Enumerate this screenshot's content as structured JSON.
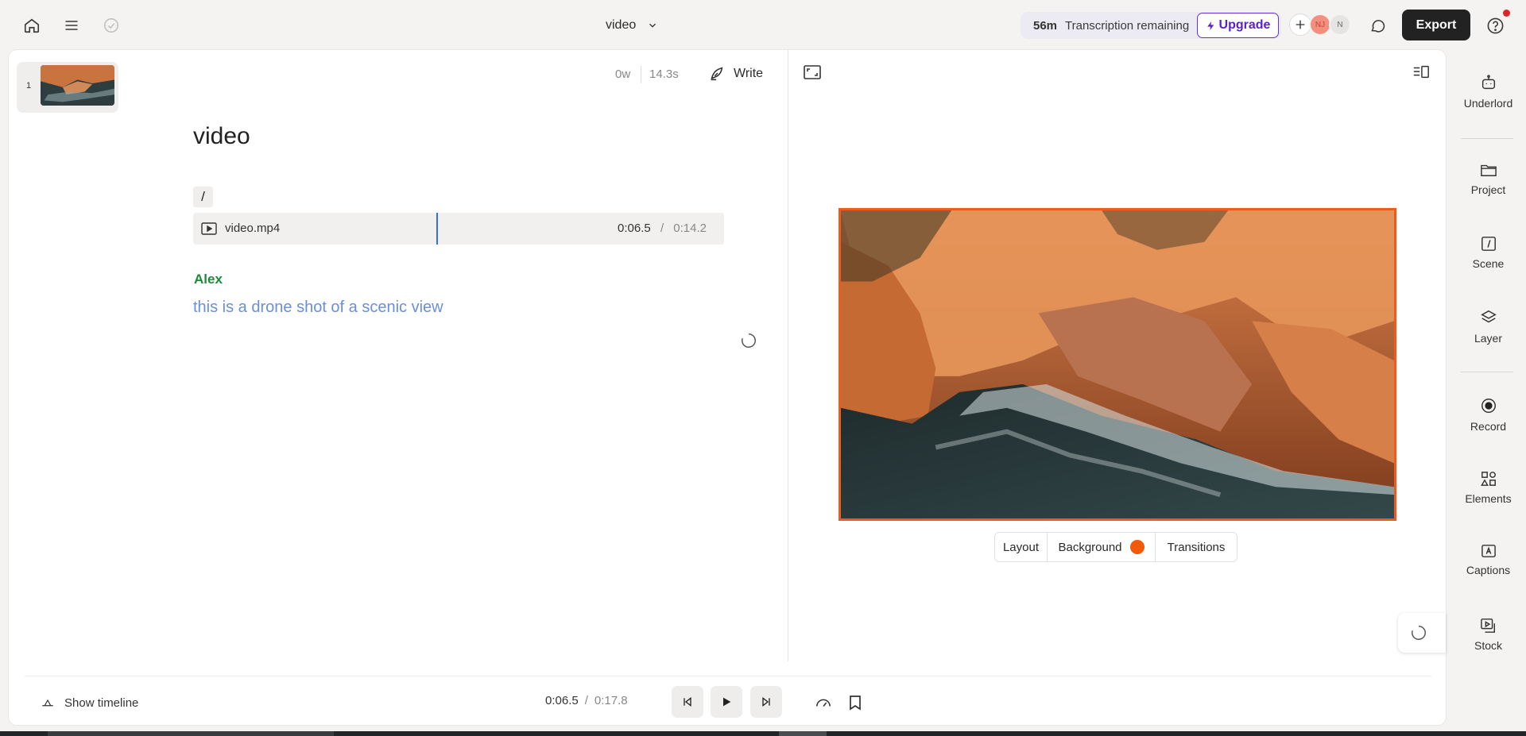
{
  "header": {
    "doc_title": "video",
    "transcription_minutes": "56m",
    "transcription_label": "Transcription remaining",
    "upgrade_label": "Upgrade",
    "avatar_1": "NJ",
    "avatar_2": "N",
    "export_label": "Export"
  },
  "editor": {
    "scene_number": "1",
    "word_count": "0w",
    "duration": "14.3s",
    "write_label": "Write",
    "title": "video",
    "slash": "/",
    "clip": {
      "name": "video.mp4",
      "current": "0:06.5",
      "separator": "/",
      "total": "0:14.2"
    },
    "speaker": "Alex",
    "transcript": "this is a drone shot of a scenic view"
  },
  "preview": {
    "segments": [
      "Layout",
      "Background",
      "Transitions"
    ],
    "background_color": "#f05a0a"
  },
  "playback": {
    "show_timeline_label": "Show timeline",
    "current": "0:06.5",
    "separator": "/",
    "total": "0:17.8"
  },
  "rail": {
    "items": [
      {
        "label": "Underlord",
        "icon": "robot-icon"
      },
      {
        "label": "Project",
        "icon": "folder-icon"
      },
      {
        "label": "Scene",
        "icon": "scene-icon"
      },
      {
        "label": "Layer",
        "icon": "layers-icon"
      },
      {
        "label": "Record",
        "icon": "record-icon"
      },
      {
        "label": "Elements",
        "icon": "elements-icon"
      },
      {
        "label": "Captions",
        "icon": "captions-icon"
      },
      {
        "label": "Stock",
        "icon": "stock-icon"
      }
    ]
  },
  "colors": {
    "accent": "#5b21c7",
    "frame_border": "#f05a1c",
    "speaker": "#1c8a3a",
    "transcript": "#6a8fd9"
  }
}
